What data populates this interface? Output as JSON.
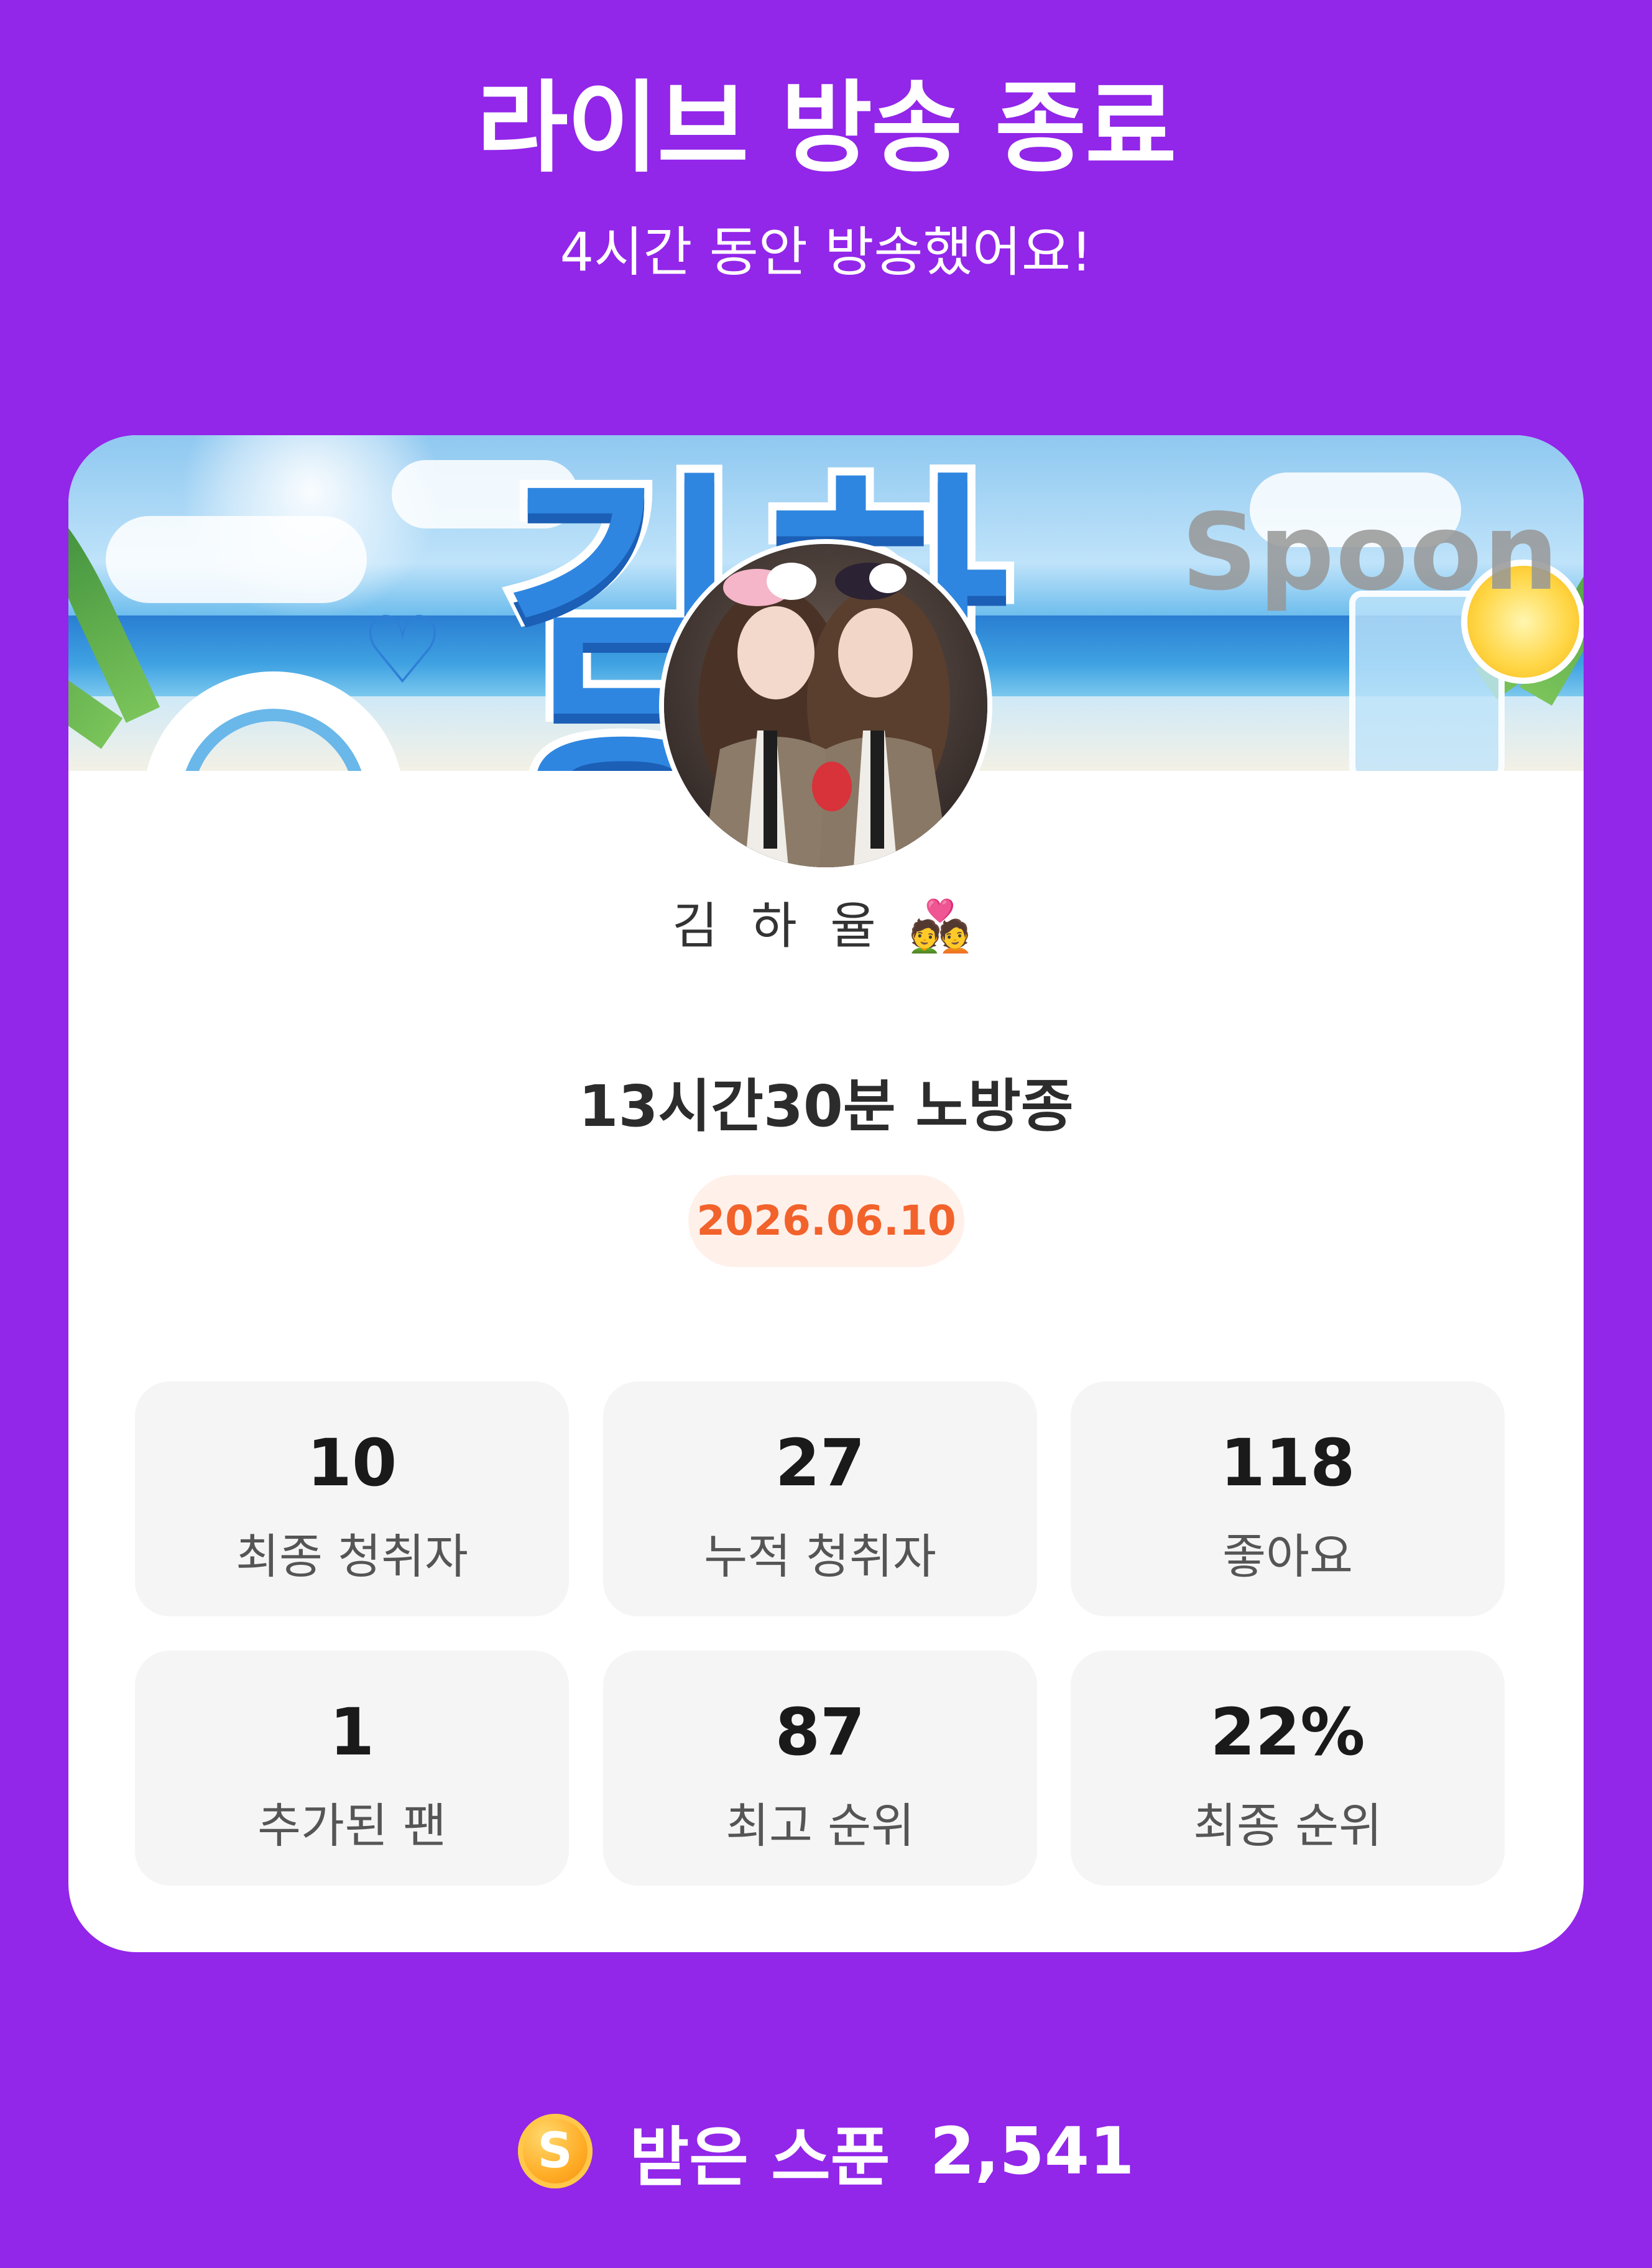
{
  "header": {
    "title": "라이브 방송 종료",
    "subtitle": "4시간 동안 방송했어요!"
  },
  "card": {
    "banner": {
      "name_art": "김하율",
      "watermark": "Spoon"
    },
    "dj_name": "김 하 율 💑",
    "broadcast_title": "13시간30분 노방종",
    "date": "2026.06.10",
    "stats": [
      {
        "value": "10",
        "label": "최종 청취자"
      },
      {
        "value": "27",
        "label": "누적 청취자"
      },
      {
        "value": "118",
        "label": "좋아요"
      },
      {
        "value": "1",
        "label": "추가된 팬"
      },
      {
        "value": "87",
        "label": "최고 순위"
      },
      {
        "value": "22%",
        "label": "최종 순위"
      }
    ]
  },
  "footer": {
    "coin_icon": "spoon-coin-icon",
    "coin_letter": "S",
    "label": "받은 스푼",
    "count": "2,541"
  },
  "colors": {
    "background": "#9226e9",
    "card": "#ffffff",
    "stat_box": "#f5f5f5",
    "date_badge_bg": "#fff0ea",
    "date_badge_text": "#f2622b",
    "coin": "#ffad27"
  }
}
